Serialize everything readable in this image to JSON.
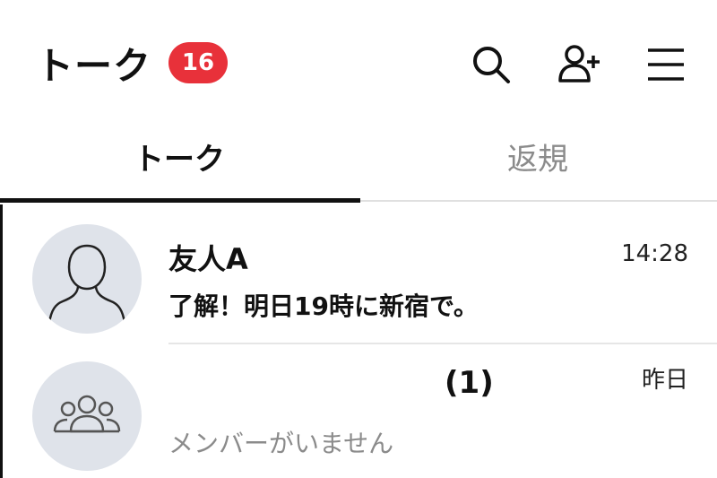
{
  "header": {
    "title": "トーク",
    "unread_badge": "16",
    "icons": [
      "search-icon",
      "add-friend-icon",
      "menu-icon"
    ],
    "badge_color": "#e8313a"
  },
  "tabs": [
    {
      "label": "トーク",
      "active": true
    },
    {
      "label": "返規",
      "active": false
    }
  ],
  "chats": [
    {
      "name": "友人A",
      "time": "14:28",
      "preview": "了解！明日19時に新宿で。",
      "avatar": "person-avatar-icon"
    },
    {
      "name": "",
      "member_count": "(1)",
      "time": "昨日",
      "preview": "メンバーがいません",
      "avatar": "group-avatar-icon"
    }
  ]
}
